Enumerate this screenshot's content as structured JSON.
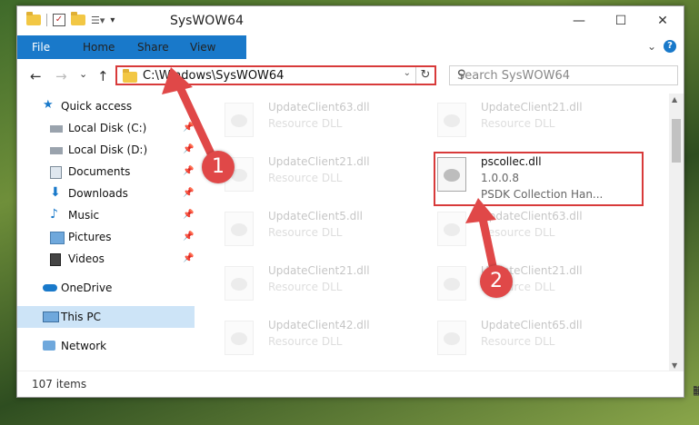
{
  "window": {
    "title": "SysWOW64",
    "minimize": "—",
    "maximize": "☐",
    "close": "✕"
  },
  "ribbon": {
    "tabs": [
      "File",
      "Home",
      "Share",
      "View"
    ],
    "expand": "⌄",
    "help": "?"
  },
  "address": {
    "back": "←",
    "forward": "→",
    "recent": "⌄",
    "up": "↑",
    "path": "C:\\Windows\\SysWOW64",
    "dropdown": "⌄",
    "refresh": "↻",
    "search_placeholder": "Search SysWOW64",
    "search_icon": "⚲"
  },
  "nav": {
    "items": [
      {
        "label": "Quick access",
        "icon": "star-icon",
        "pinned": false
      },
      {
        "label": "Local Disk (C:)",
        "icon": "drive-icon",
        "pinned": true
      },
      {
        "label": "Local Disk (D:)",
        "icon": "drive-icon",
        "pinned": true
      },
      {
        "label": "Documents",
        "icon": "documents-icon",
        "pinned": true
      },
      {
        "label": "Downloads",
        "icon": "downloads-icon",
        "pinned": true
      },
      {
        "label": "Music",
        "icon": "music-icon",
        "pinned": true
      },
      {
        "label": "Pictures",
        "icon": "pictures-icon",
        "pinned": true
      },
      {
        "label": "Videos",
        "icon": "videos-icon",
        "pinned": true
      },
      {
        "label": "OneDrive",
        "icon": "onedrive-icon",
        "pinned": false
      },
      {
        "label": "This PC",
        "icon": "pc-icon",
        "pinned": false
      },
      {
        "label": "Network",
        "icon": "network-icon",
        "pinned": false
      }
    ],
    "pin": "📌"
  },
  "files": [
    {
      "name": "UpdateClient63.dll",
      "sub": "Resource DLL"
    },
    {
      "name": "UpdateClient21.dll",
      "sub": "Resource DLL"
    },
    {
      "name": "UpdateClient21.dll",
      "sub": "Resource DLL"
    },
    {
      "name": "pscollec.dll",
      "version": "1.0.0.8",
      "sub": "PSDK Collection Han..."
    },
    {
      "name": "UpdateClient5.dll",
      "sub": "Resource DLL"
    },
    {
      "name": "UpdateClient63.dll",
      "sub": "Resource DLL"
    },
    {
      "name": "UpdateClient21.dll",
      "sub": "Resource DLL"
    },
    {
      "name": "UpdateClient21.dll",
      "sub": "Resource DLL"
    },
    {
      "name": "UpdateClient42.dll",
      "sub": "Resource DLL"
    },
    {
      "name": "UpdateClient65.dll",
      "sub": "Resource DLL"
    }
  ],
  "status": {
    "count": "107 items",
    "view_details": "☷",
    "view_tiles": "▦"
  },
  "callouts": [
    "1",
    "2"
  ],
  "colors": {
    "accent": "#1979ca",
    "highlight": "#d83a3a",
    "selected": "#cde4f7"
  }
}
